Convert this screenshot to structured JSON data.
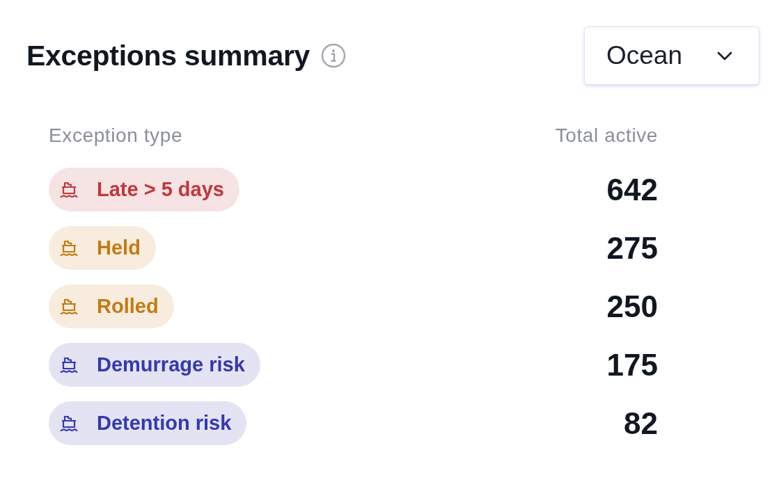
{
  "header": {
    "title": "Exceptions summary"
  },
  "mode_dropdown": {
    "value": "Ocean"
  },
  "table": {
    "columns": [
      "Exception type",
      "Total active"
    ],
    "rows": [
      {
        "exception_type": "Late > 5 days",
        "color": "#c0373d",
        "total_active": "642"
      },
      {
        "exception_type": "Held",
        "color": "#c47a12",
        "total_active": "275"
      },
      {
        "exception_type": "Rolled",
        "color": "#c47a12",
        "total_active": "250"
      },
      {
        "exception_type": "Demurrage risk",
        "color": "#3538b0",
        "total_active": "175"
      },
      {
        "exception_type": "Detention risk",
        "color": "#3538b0",
        "total_active": "82"
      }
    ]
  }
}
